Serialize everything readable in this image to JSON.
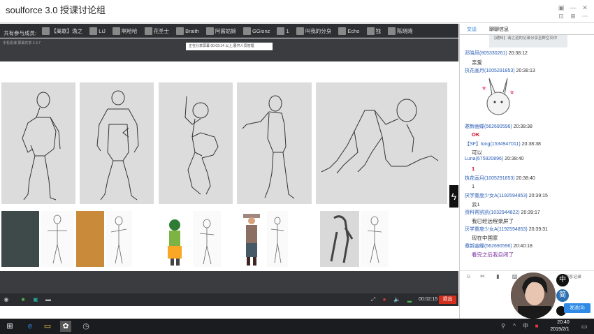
{
  "app": {
    "title": "soulforce 3.0 授课讨论组"
  },
  "members": {
    "label": "共有参与成员:",
    "list": [
      "【离歌】逸之",
      "LiJ",
      "啊哈哈",
      "花圣士",
      "Braith",
      "阿酱姑娘",
      "GGionz",
      "1",
      "叫我的分身",
      "Echo",
      "独",
      "陈晓晓"
    ]
  },
  "video": {
    "top_text": "手机看课  屏幕共享  2.3.7",
    "tooltip": "正在分享屏幕  00:03:14     以上,展开人员管理",
    "time": "00:02:15",
    "exit_label": "退出"
  },
  "chat": {
    "tabs": [
      "交谈",
      "聊聊信息"
    ],
    "notice": "【通知】请之道的记录分享至群空间中",
    "messages": [
      {
        "name": "邓晓凤",
        "id": "(805330261)",
        "time": "20:38:12",
        "body": "亲爱",
        "body_class": ""
      },
      {
        "name": "执花画月",
        "id": "(1005291853)",
        "time": "20:38:13",
        "body": "",
        "body_class": ""
      },
      {
        "name": "邀新幽蝶",
        "id": "(562690596)",
        "time": "20:38:38",
        "body": "OK",
        "body_class": "red"
      },
      {
        "name": "【SF】tong",
        "id": "(1534947011)",
        "time": "20:38:38",
        "body": "可以",
        "body_class": ""
      },
      {
        "name": "Luna",
        "id": "(675920896)",
        "time": "20:38:40",
        "body": "1",
        "body_class": "red"
      },
      {
        "name": "执花画月",
        "id": "(1005291853)",
        "time": "20:38:40",
        "body": "1",
        "body_class": ""
      },
      {
        "name": "厌学重度少女A",
        "id": "(1192594853)",
        "time": "20:39:15",
        "body": "云1",
        "body_class": ""
      },
      {
        "name": "资料帮凯凯",
        "id": "(1032944822)",
        "time": "20:39:17",
        "body": "我已经远程录屏了",
        "body_class": ""
      },
      {
        "name": "厌学重度少女A",
        "id": "(1192594853)",
        "time": "20:39:31",
        "body": "现在中国家",
        "body_class": ""
      },
      {
        "name": "邀新幽蝶",
        "id": "(562690596)",
        "time": "20:40:18",
        "body": "看完之后我自闭了",
        "body_class": "purple"
      }
    ],
    "record_label": "消息记录",
    "send_label": "发送(S)",
    "badges": [
      "中",
      "简"
    ]
  },
  "taskbar": {
    "time": "20:40",
    "date": "2019/2/1",
    "lang": "中"
  }
}
